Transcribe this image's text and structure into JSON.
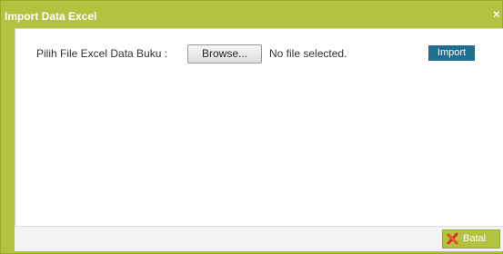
{
  "dialog": {
    "title": "Import Data Excel",
    "close_glyph": "×"
  },
  "form": {
    "label": "Pilih File Excel Data Buku :",
    "browse_label": "Browse...",
    "file_status": "No file selected.",
    "import_label": "Import"
  },
  "footer": {
    "cancel_label": "Batal",
    "cancel_icon": "cancel-x-icon"
  },
  "colors": {
    "frame": "#b3c23f",
    "import_button": "#1f6f93",
    "cancel_icon": "#e0302a"
  }
}
